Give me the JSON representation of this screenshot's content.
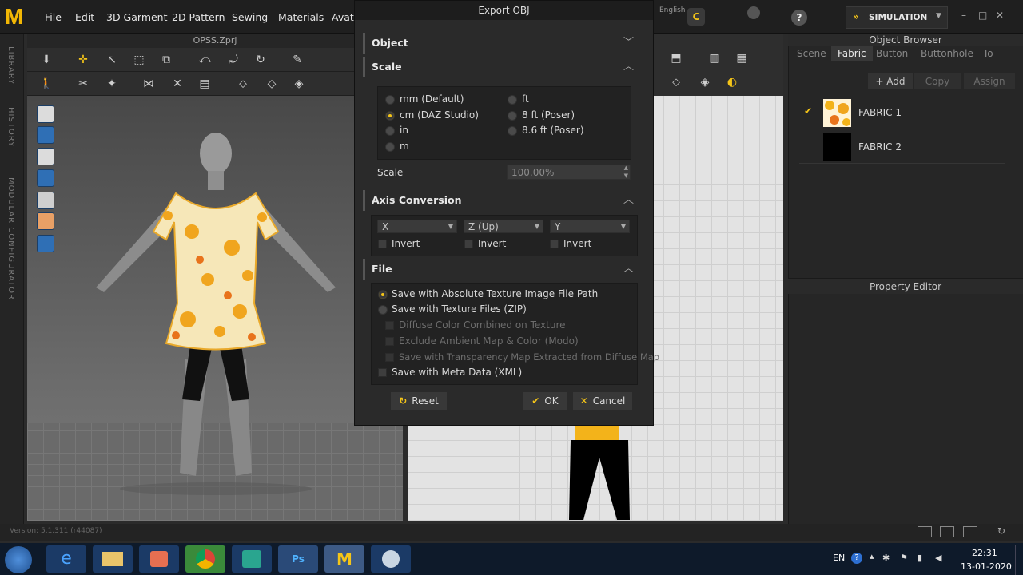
{
  "app": {
    "menu": [
      "File",
      "Edit",
      "3D Garment",
      "2D Pattern",
      "Sewing",
      "Materials",
      "Avata"
    ],
    "project_title": "OPSS.Zprj",
    "simulation_label": "SIMULATION",
    "language": "English",
    "left_labels": [
      "LIBRARY",
      "HISTORY",
      "MODULAR CONFIGURATOR"
    ],
    "version": "Version: 5.1.311 (r44087)"
  },
  "object_browser": {
    "title": "Object Browser",
    "tabs": [
      "Scene",
      "Fabric",
      "Button",
      "Buttonhole",
      "To"
    ],
    "active_tab": "Fabric",
    "actions": [
      "+ Add",
      "Copy",
      "Assign"
    ],
    "fabrics": [
      {
        "name": "FABRIC 1",
        "checked": true,
        "swatch": "#f3b31a"
      },
      {
        "name": "FABRIC 2",
        "checked": false,
        "swatch": "#000000"
      }
    ]
  },
  "property_editor": {
    "title": "Property Editor"
  },
  "dialog": {
    "title": "Export OBJ",
    "sections": {
      "object": "Object",
      "scale": "Scale",
      "axis": "Axis Conversion",
      "file": "File"
    },
    "units_col1": [
      "mm (Default)",
      "cm (DAZ Studio)",
      "in",
      "m"
    ],
    "units_col2": [
      "ft",
      "8 ft (Poser)",
      "8.6 ft (Poser)"
    ],
    "selected_unit": "cm (DAZ Studio)",
    "scale_label": "Scale",
    "scale_value": "100.00%",
    "axes": [
      {
        "value": "X",
        "invert": "Invert"
      },
      {
        "value": "Z (Up)",
        "invert": "Invert"
      },
      {
        "value": "Y",
        "invert": "Invert"
      }
    ],
    "file_options": [
      "Save with Absolute Texture Image File Path",
      "Save with Texture Files (ZIP)"
    ],
    "file_sub_options": [
      "Diffuse Color Combined on Texture",
      "Exclude Ambient Map & Color (Modo)",
      "Save with Transparency Map Extracted from Diffuse Map"
    ],
    "meta_option": "Save with Meta Data (XML)",
    "buttons": {
      "reset": "Reset",
      "ok": "OK",
      "cancel": "Cancel"
    }
  },
  "taskbar": {
    "lang": "EN",
    "time": "22:31",
    "date": "13-01-2020"
  },
  "colors": {
    "accent": "#f5c518",
    "dialog_bg": "#2a2a2a"
  }
}
